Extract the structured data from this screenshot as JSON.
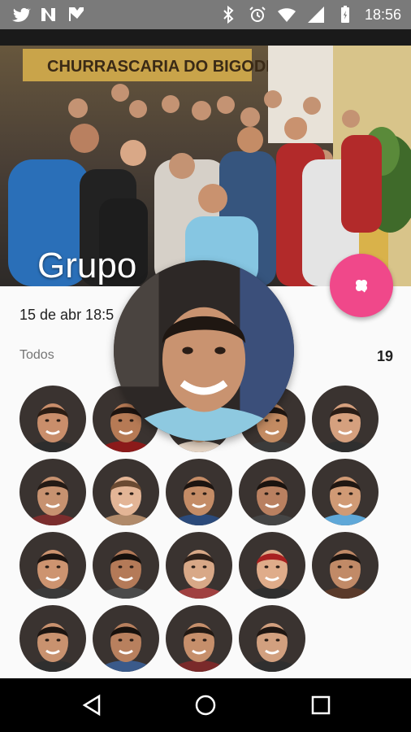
{
  "status": {
    "time": "18:56"
  },
  "header": {
    "sign_text": "CHURRASCARIA DO BIGODE",
    "title": "Grupo"
  },
  "event": {
    "date": "15 de abr 18:5"
  },
  "section": {
    "label": "Todos",
    "count": "19"
  },
  "colors": {
    "accent": "#f0488a",
    "statusbar": "#7a7a7a"
  },
  "icons": [
    "twitter-icon",
    "n-icon",
    "tasks-icon",
    "bluetooth-icon",
    "alarm-icon",
    "wifi-icon",
    "battery-icon",
    "clover-icon",
    "back-icon",
    "home-icon",
    "recents-icon"
  ],
  "members": [
    {
      "skin": "#c98e6b",
      "hair": "#2b1d14",
      "shirt": "#2d2d2d"
    },
    {
      "skin": "#b67a55",
      "hair": "#1e1410",
      "shirt": "#8b1a1a"
    },
    {
      "skin": "#cfa07a",
      "hair": "#3b2a1e",
      "shirt": "#e6d6c6"
    },
    {
      "skin": "#c38b62",
      "hair": "#1f1611",
      "shirt": "#3b3b3b"
    },
    {
      "skin": "#d5a07e",
      "hair": "#2a1d16",
      "shirt": "#2f2f2f"
    },
    {
      "skin": "#c79270",
      "hair": "#231a15",
      "shirt": "#7b2d2d"
    },
    {
      "skin": "#e3b596",
      "hair": "#6a4a32",
      "shirt": "#b08a6a"
    },
    {
      "skin": "#c48c66",
      "hair": "#1c1410",
      "shirt": "#2b4a7a"
    },
    {
      "skin": "#b98060",
      "hair": "#1a130f",
      "shirt": "#454545"
    },
    {
      "skin": "#d09a75",
      "hair": "#201712",
      "shirt": "#5fa8d8"
    },
    {
      "skin": "#cd9470",
      "hair": "#1d1511",
      "shirt": "#3a3a3a"
    },
    {
      "skin": "#b47a58",
      "hair": "#17110d",
      "shirt": "#4a4a4a"
    },
    {
      "skin": "#d8a887",
      "hair": "#2e2019",
      "shirt": "#a04040"
    },
    {
      "skin": "#dfac8a",
      "hair": "#a82020",
      "shirt": "#2f2f2f"
    },
    {
      "skin": "#c18a67",
      "hair": "#1b1410",
      "shirt": "#5a3a2a"
    },
    {
      "skin": "#c9926f",
      "hair": "#1c1511",
      "shirt": "#2f2f2f"
    },
    {
      "skin": "#b8805e",
      "hair": "#17110d",
      "shirt": "#3a5a8a"
    },
    {
      "skin": "#c68f6b",
      "hair": "#221913",
      "shirt": "#7a2a2a"
    },
    {
      "skin": "#d2a07f",
      "hair": "#1e1612",
      "shirt": "#2f2f2f"
    }
  ]
}
